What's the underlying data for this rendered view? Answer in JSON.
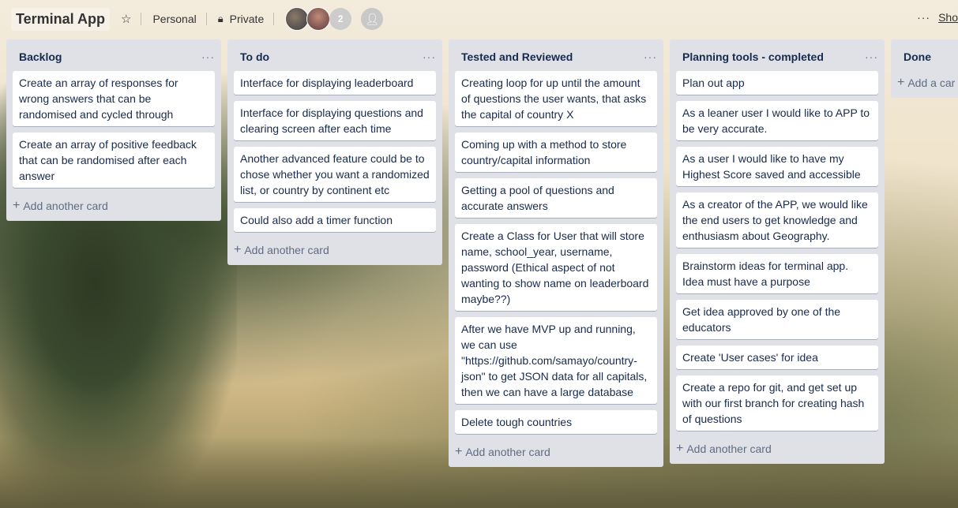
{
  "header": {
    "board_title": "Terminal App",
    "personal_label": "Personal",
    "visibility_label": "Private",
    "member_count": "2",
    "show_menu_label": "Sho"
  },
  "lists": [
    {
      "title": "Backlog",
      "cards": [
        "Create an array of responses for wrong answers that can be randomised and cycled through",
        "Create an array of positive feedback that can be randomised after each answer"
      ],
      "add_label": "Add another card"
    },
    {
      "title": "To do",
      "cards": [
        "Interface for displaying leaderboard",
        "Interface for displaying questions and clearing screen after each time",
        "Another advanced feature could be to chose whether you want a randomized list, or country by continent etc",
        "Could also add a timer function"
      ],
      "add_label": "Add another card"
    },
    {
      "title": "Tested and Reviewed",
      "cards": [
        "Creating loop for up until the amount of questions the user wants, that asks the capital of country X",
        "Coming up with a method to store country/capital information",
        "Getting a pool of questions and accurate answers",
        "Create a Class for User that will store name, school_year, username, password (Ethical aspect of not wanting to show name on leaderboard maybe??)",
        "After we have MVP up and running, we can use \"https://github.com/samayo/country-json\" to get JSON data for all capitals, then we can have a large database",
        "Delete tough countries"
      ],
      "add_label": "Add another card"
    },
    {
      "title": "Planning tools - completed",
      "cards": [
        "Plan out app",
        "As a leaner user I would like to APP to be very accurate.",
        "As a user I would like to have my Highest Score saved and accessible",
        "As a creator of the APP, we would like the end users to get knowledge and enthusiasm about Geography.",
        "Brainstorm ideas for terminal app. Idea must have a purpose",
        "Get idea approved by one of the educators",
        "Create 'User cases' for idea",
        "Create a repo for git, and get set up with our first branch for creating hash of questions"
      ],
      "add_label": "Add another card"
    },
    {
      "title": "Done",
      "cards": [],
      "add_label": "Add a car"
    }
  ]
}
